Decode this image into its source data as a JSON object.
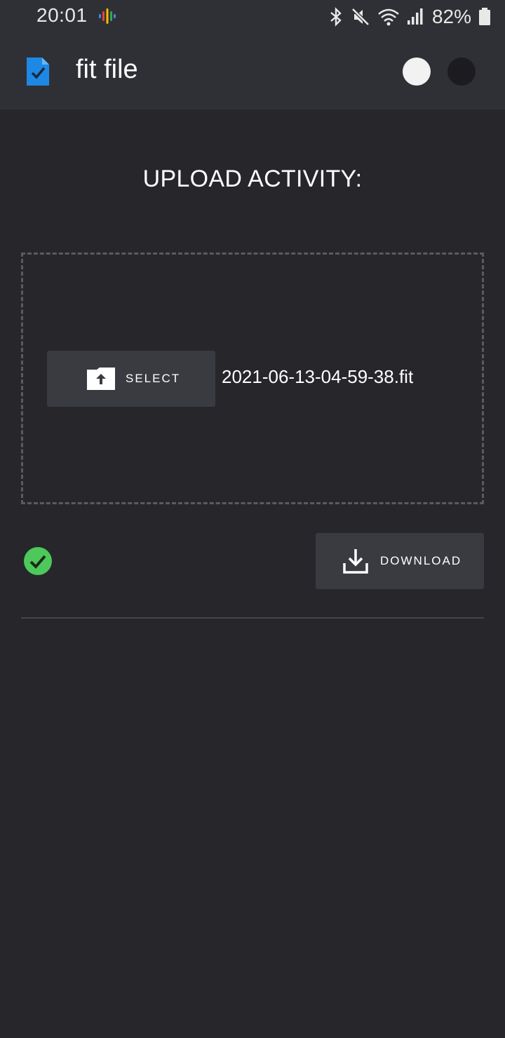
{
  "status_bar": {
    "time": "20:01",
    "battery": "82%",
    "icons": [
      "podcast-icon",
      "bluetooth-icon",
      "mute-icon",
      "wifi-icon",
      "signal-icon",
      "battery-icon"
    ]
  },
  "app_bar": {
    "title": "fit file",
    "logo_icon": "file-check-icon",
    "theme_toggles": [
      "light-theme-toggle",
      "dark-theme-toggle"
    ]
  },
  "main": {
    "heading": "UPLOAD ACTIVITY:",
    "select_button_label": "SELECT",
    "selected_file": "2021-06-13-04-59-38.fit",
    "download_button_label": "DOWNLOAD",
    "status": "success"
  },
  "colors": {
    "background": "#26262b",
    "app_bar": "#2f3035",
    "button": "#3a3b40",
    "accent_blue": "#1e88e5",
    "success_green": "#4cc95a"
  }
}
